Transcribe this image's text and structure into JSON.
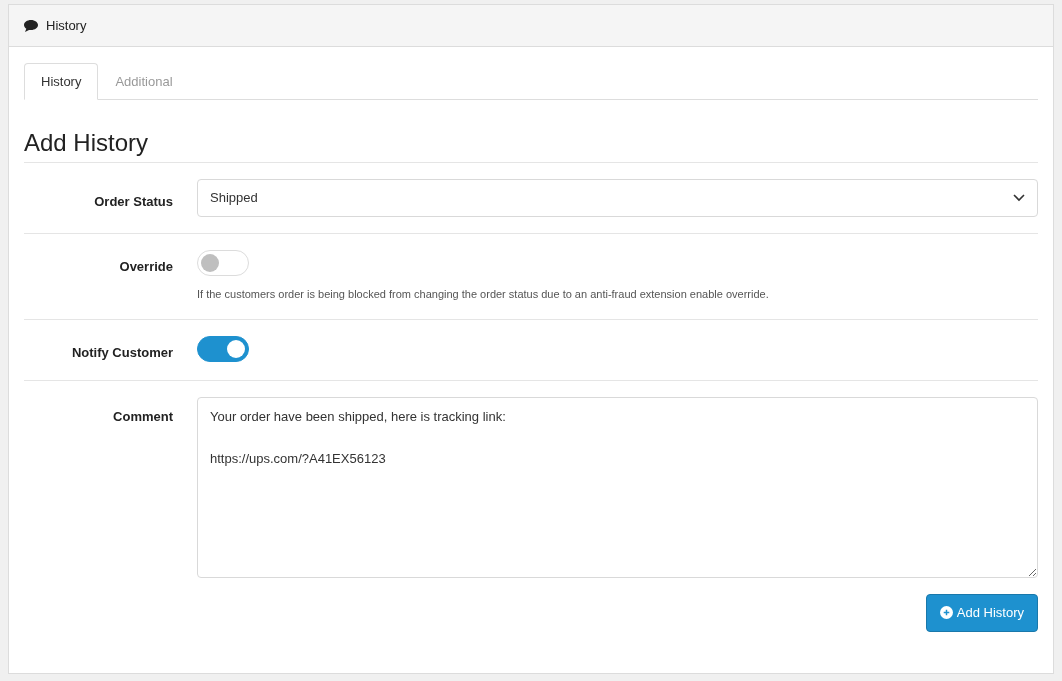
{
  "panel": {
    "title": "History"
  },
  "tabs": [
    {
      "label": "History",
      "selected": true
    },
    {
      "label": "Additional",
      "selected": false
    }
  ],
  "section_title": "Add History",
  "form": [
    {
      "kind": "select",
      "label": "Order Status",
      "value": "Shipped"
    },
    {
      "kind": "switch",
      "label": "Override",
      "on": false,
      "help": "If the customers order is being blocked from changing the order status due to an anti-fraud extension enable override."
    },
    {
      "kind": "switch",
      "label": "Notify Customer",
      "on": true
    },
    {
      "kind": "textarea",
      "label": "Comment",
      "value": "Your order have been shipped, here is tracking link:\n\nhttps://ups.com/?A41EX56123"
    }
  ],
  "button": {
    "label": "Add History"
  }
}
